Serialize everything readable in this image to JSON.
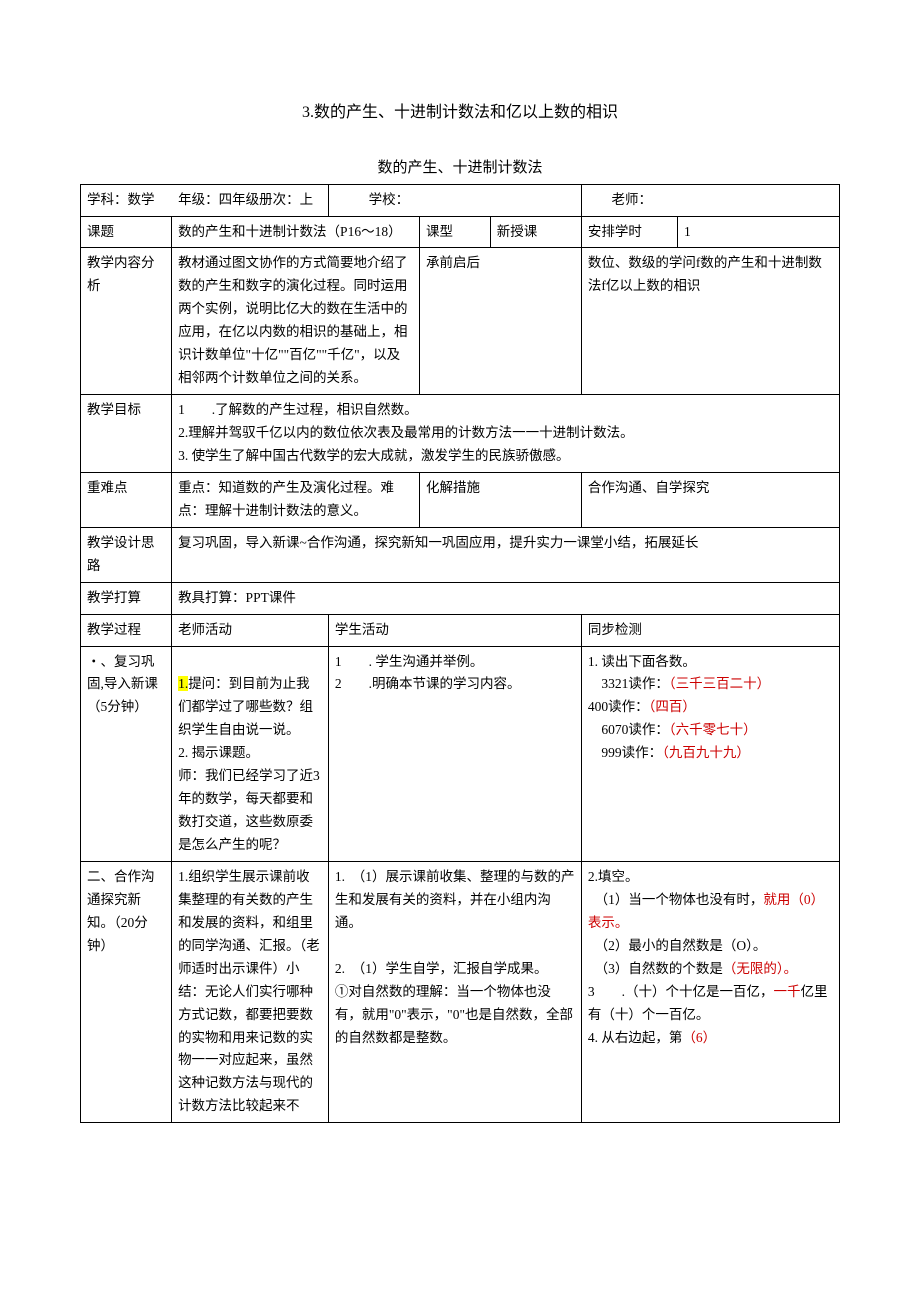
{
  "doc": {
    "title": "3.数的产生、十进制计数法和亿以上数的相识",
    "subtitle": "数的产生、十进制计数法"
  },
  "header": {
    "subject_label": "学科：数学",
    "grade_label": "年级：四年级册次：上",
    "school_label": "学校：",
    "teacher_label": "老师："
  },
  "row_topic": {
    "label": "课题",
    "value": "数的产生和十进制计数法（P16～18）",
    "type_label": "课型",
    "type_value": "新授课",
    "hours_label": "安排学时",
    "hours_value": "1"
  },
  "row_content": {
    "label": "教学内容分析",
    "value": "教材通过图文协作的方式简要地介绍了数的产生和数字的演化过程。同时运用两个实例，说明比亿大的数在生活中的应用，在亿以内数的相识的基础上，相识计数单位\"十亿\"\"百亿\"\"千亿\"，以及相邻两个计数单位之间的关系。",
    "link_label": "承前启后",
    "link_value": "数位、数级的学问f数的产生和十进制数法f亿以上数的相识"
  },
  "row_goal": {
    "label": "教学目标",
    "value": "1　　.了解数的产生过程，相识自然数。\n2.理解并驾驭千亿以内的数位依次表及最常用的计数方法一一十进制计数法。\n3. 使学生了解中国古代数学的宏大成就，激发学生的民族骄傲感。"
  },
  "row_diff": {
    "label": "重难点",
    "value": "重点：知道数的产生及演化过程。难点：理解十进制计数法的意义。",
    "measure_label": "化解措施",
    "measure_value": "合作沟通、自学探究"
  },
  "row_design": {
    "label": "教学设计思路",
    "value": "复习巩固，导入新课~合作沟通，探究新知一巩固应用，提升实力一课堂小结，拓展延长"
  },
  "row_prep": {
    "label": "教学打算",
    "value": "教具打算：PPT课件"
  },
  "row_process_head": {
    "label": "教学过程",
    "c1": "老师活动",
    "c2": "学生活动",
    "c3": "同步检测"
  },
  "section1": {
    "label_pre": "・、复习巩固,导入新课（5分钟）",
    "teacher_pre": "1.",
    "teacher": "提问：到目前为止我们都学过了哪些数？组织学生自由说一说。\n2. 揭示课题。\n师：我们已经学习了近3年的数学，每天都要和数打交道，这些数原委是怎么产生的呢？",
    "student": "1　　. 学生沟通并举例。\n2　　.明确本节课的学习内容。",
    "test_l1": "1. 读出下面各数。",
    "test_l2a": "　3321读作：",
    "test_l2b": "（三千三百二十）",
    "test_l3a": "400读作：",
    "test_l3b": "（四百）",
    "test_l4a": "　6070读作：",
    "test_l4b": "（六千零七十）",
    "test_l5a": "　999读作：",
    "test_l5b": "（九百九十九）"
  },
  "section2": {
    "label": "二、合作沟通探究新知。（20分钟）",
    "teacher": "1.组织学生展示课前收集整理的有关数的产生和发展的资料，和组里的同学沟通、汇报。（老师适时出示课件）小结：无论人们实行哪种方式记数，都要把要数的实物和用来记数的实物一一对应起来，虽然这种记数方法与现代的计数方法比较起来不",
    "student": "1.　（1）展示课前收集、整理的与数的产生和发展有关的资料，并在小组内沟通。\n\n2.　（1）学生自学，汇报自学成果。\n①对自然数的理解：当一个物体也没有，就用\"0\"表示，\"0\"也是自然数，全部的自然数都是整数。",
    "test_l1": "2.填空。",
    "test_l2a": "　（1）当一个物体也没有时，",
    "test_l2b": "就用（0）表示。",
    "test_l3": "　（2）最小的自然数是（O）。",
    "test_l4a": "　（3）自然数的个数是",
    "test_l4b": "（无限的）。",
    "test_l5a": "3　　.（十）个十亿是一百亿，",
    "test_l5b": "一千",
    "test_l5c": "亿里有（十）个一百亿。",
    "test_l6a": "4. 从右边起，第",
    "test_l6b": "（6）"
  }
}
